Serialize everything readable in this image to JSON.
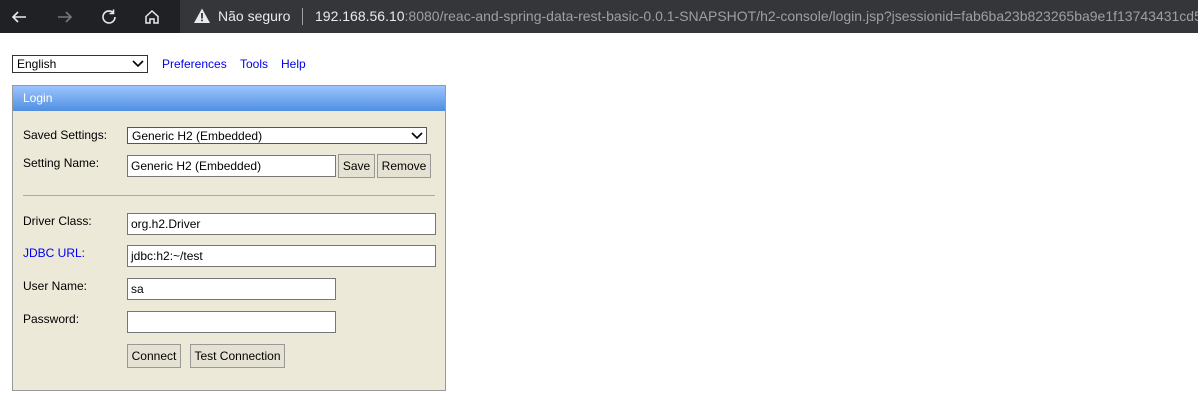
{
  "browser": {
    "security_label": "Não seguro",
    "url_host": "192.168.56.10",
    "url_rest": ":8080/reac-and-spring-data-rest-basic-0.0.1-SNAPSHOT/h2-console/login.jsp?jsessionid=fab6ba23b823265ba9e1f13743431cd5"
  },
  "toolbar": {
    "language": "English",
    "links": [
      "Preferences",
      "Tools",
      "Help"
    ]
  },
  "login": {
    "title": "Login",
    "saved_settings_label": "Saved Settings:",
    "saved_settings_value": "Generic H2 (Embedded)",
    "setting_name_label": "Setting Name:",
    "setting_name_value": "Generic H2 (Embedded)",
    "save_label": "Save",
    "remove_label": "Remove",
    "driver_class_label": "Driver Class:",
    "driver_class_value": "org.h2.Driver",
    "jdbc_url_label": "JDBC URL:",
    "jdbc_url_value": "jdbc:h2:~/test",
    "user_name_label": "User Name:",
    "user_name_value": "sa",
    "password_label": "Password:",
    "password_value": "",
    "connect_label": "Connect",
    "test_connection_label": "Test Connection"
  }
}
